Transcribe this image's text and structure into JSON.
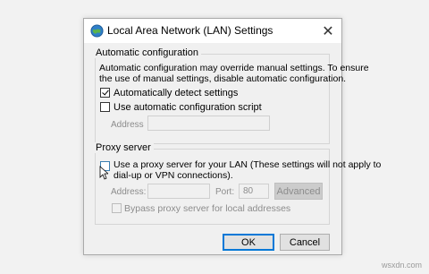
{
  "window": {
    "title": "Local Area Network (LAN) Settings",
    "close_glyph": "✕",
    "icon": "network-globe-icon"
  },
  "auto_config": {
    "group_label": "Automatic configuration",
    "description_line1": "Automatic configuration may override manual settings.  To ensure",
    "description_line2": "the use of manual settings, disable automatic configuration.",
    "detect_label": "Automatically detect settings",
    "detect_checked": true,
    "script_label": "Use automatic configuration script",
    "script_checked": false,
    "address_label": "Address",
    "address_value": ""
  },
  "proxy": {
    "group_label": "Proxy server",
    "use_proxy_line1": "Use a proxy server for your LAN (These settings will not apply to",
    "use_proxy_line2": "dial-up or VPN connections).",
    "use_proxy_checked": false,
    "address_label": "Address:",
    "address_value": "",
    "port_label": "Port:",
    "port_value": "80",
    "advanced_label": "Advanced",
    "bypass_label": "Bypass proxy server for local addresses",
    "bypass_checked": false
  },
  "buttons": {
    "ok_label": "OK",
    "cancel_label": "Cancel"
  },
  "watermark": "wsxdn.com"
}
